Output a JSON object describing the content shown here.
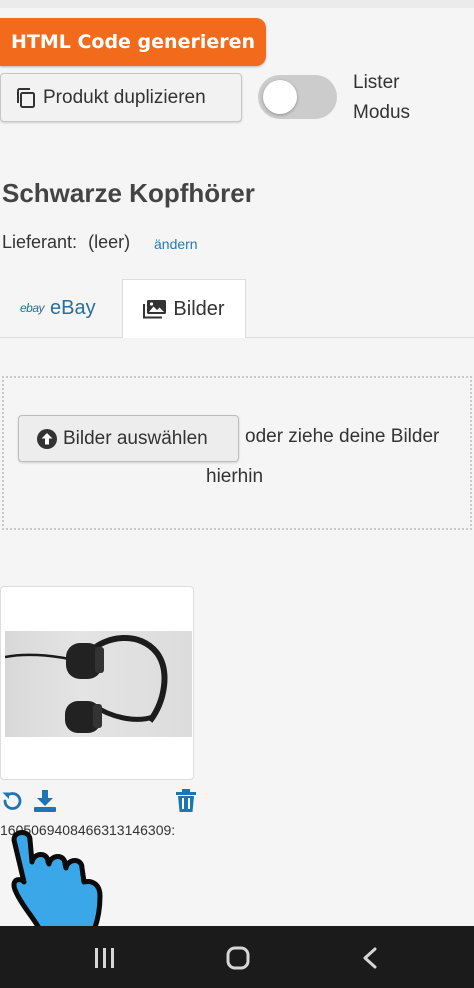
{
  "toolbar": {
    "generate_html_label": "HTML Code generieren",
    "duplicate_product_label": "Produkt duplizieren",
    "lister_mode_label_line1": "Lister",
    "lister_mode_label_line2": "Modus",
    "lister_mode_on": false
  },
  "product": {
    "title": "Schwarze Kopfhörer",
    "supplier_label": "Lieferant:",
    "supplier_value": "(leer)",
    "supplier_change_link": "ändern"
  },
  "tabs": [
    {
      "logo": "ebay",
      "label": "eBay",
      "active": false
    },
    {
      "label": "Bilder",
      "active": true
    }
  ],
  "uploader": {
    "choose_button_label": "Bilder auswählen",
    "drop_hint_line1": "oder ziehe deine Bilder",
    "drop_hint_line2": "hierhin"
  },
  "images": [
    {
      "filename": "1605069408466313146309:",
      "alt": "headphones photo"
    }
  ],
  "icons": {
    "rotate": "rotate-icon",
    "download": "download-icon",
    "delete": "trash-icon",
    "copy": "copy-icon",
    "upload": "upload-circle-icon",
    "images_tab": "images-icon"
  },
  "colors": {
    "accent_orange": "#f26b1d",
    "link_blue": "#2a7bb0",
    "icon_blue": "#1d76b3",
    "pointer_blue": "#3aa8e8",
    "navbar_bg": "#1b1b1b"
  }
}
